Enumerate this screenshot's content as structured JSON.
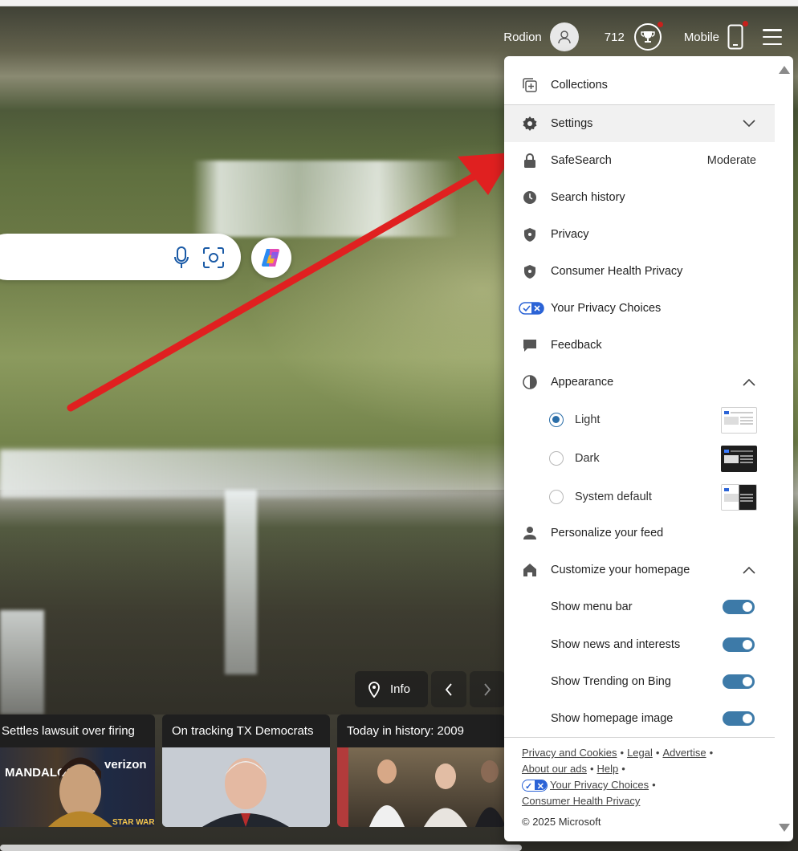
{
  "header": {
    "user_name": "Rodion",
    "points": "712",
    "mobile_label": "Mobile"
  },
  "info_button": {
    "label": "Info"
  },
  "news": [
    {
      "title": "Settles lawsuit over firing"
    },
    {
      "title": "On tracking TX Democrats"
    },
    {
      "title": "Today in history: 2009"
    }
  ],
  "news_image_text": {
    "verizon": "verizon",
    "mandalorian": "MANDALORIAN",
    "star_wars": "STAR WARS"
  },
  "menu": {
    "collections": "Collections",
    "settings": "Settings",
    "safesearch": "SafeSearch",
    "safesearch_value": "Moderate",
    "search_history": "Search history",
    "privacy": "Privacy",
    "consumer_health_privacy": "Consumer Health Privacy",
    "your_privacy_choices": "Your Privacy Choices",
    "feedback": "Feedback",
    "appearance": "Appearance",
    "theme_light": "Light",
    "theme_dark": "Dark",
    "theme_system": "System default",
    "selected_theme": "Light",
    "personalize_feed": "Personalize your feed",
    "customize_homepage": "Customize your homepage",
    "show_menu_bar": "Show menu bar",
    "show_news": "Show news and interests",
    "show_trending": "Show Trending on Bing",
    "show_homepage_image": "Show homepage image",
    "toggles_on": [
      true,
      true,
      true,
      true
    ]
  },
  "footer": {
    "privacy_cookies": "Privacy and Cookies",
    "legal": "Legal",
    "advertise": "Advertise",
    "about_ads": "About our ads",
    "help": "Help",
    "privacy_choices": "Your Privacy Choices",
    "consumer_health": "Consumer Health Privacy",
    "bullet": "•",
    "copyright": "© 2025 Microsoft"
  },
  "colors": {
    "accent_toggle": "#3d7aa8",
    "arrow": "#e02020",
    "notification_dot": "#c8201c"
  }
}
